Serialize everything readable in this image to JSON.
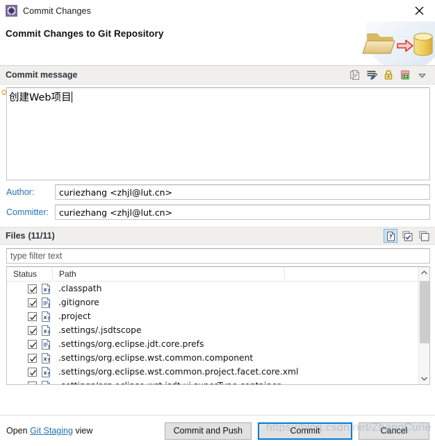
{
  "window": {
    "title": "Commit Changes",
    "icon": "commit-gear-icon",
    "close_label": "✕"
  },
  "header": {
    "title": "Commit Changes to Git Repository",
    "art": "folder-to-repository-icon"
  },
  "commit_message": {
    "section_label": "Commit message",
    "value": "创建Web项目",
    "toolbar": [
      {
        "name": "insert-signed-off-icon",
        "tooltip": "Add Signed-off-by"
      },
      {
        "name": "insert-change-id-icon",
        "tooltip": "Add Change-Id"
      },
      {
        "name": "amend-lock-icon",
        "tooltip": "Amend"
      },
      {
        "name": "sign-commit-icon",
        "tooltip": "Sign Commit"
      },
      {
        "name": "chevron-down-icon",
        "tooltip": "More"
      }
    ]
  },
  "author": {
    "label": "Author:",
    "value": "curiezhang <zhjl@lut.cn>"
  },
  "committer": {
    "label": "Committer:",
    "value": "curiezhang <zhjl@lut.cn>"
  },
  "files": {
    "title": "Files",
    "count": "(11/11)",
    "tools": [
      {
        "name": "show-untracked-files-icon",
        "active": true
      },
      {
        "name": "select-all-icon",
        "active": false
      },
      {
        "name": "deselect-all-icon",
        "active": false
      }
    ],
    "filter_placeholder": "type filter text",
    "columns": [
      "Status",
      "Path"
    ],
    "rows": [
      {
        "checked": true,
        "icon": "xml-file-icon",
        "path": ".classpath"
      },
      {
        "checked": true,
        "icon": "text-file-icon",
        "path": ".gitignore"
      },
      {
        "checked": true,
        "icon": "xml-file-icon",
        "path": ".project"
      },
      {
        "checked": true,
        "icon": "xml-file-icon",
        "path": ".settings/.jsdtscope"
      },
      {
        "checked": true,
        "icon": "text-file-icon",
        "path": ".settings/org.eclipse.jdt.core.prefs"
      },
      {
        "checked": true,
        "icon": "xml-file-icon",
        "path": ".settings/org.eclipse.wst.common.component"
      },
      {
        "checked": true,
        "icon": "xml-file-icon",
        "path": ".settings/org.eclipse.wst.common.project.facet.core.xml"
      },
      {
        "checked": true,
        "icon": "text-file-icon",
        "path": ".settings/org.eclipse.wst.jsdt.ui.superType.container"
      }
    ]
  },
  "footer": {
    "open_prefix": "Open ",
    "open_link": "Git Staging",
    "open_suffix": " view",
    "buttons": [
      {
        "label": "Commit and Push",
        "default": false
      },
      {
        "label": "Commit",
        "default": true
      },
      {
        "label": "Cancel",
        "default": false
      }
    ]
  },
  "watermark": "https://blog.csdn.net/ZhangCurie",
  "colors": {
    "accent_link": "#2372b5",
    "default_button_border": "#0078d7",
    "section_bar": "#f0efeb",
    "topline": "#1f4e79"
  }
}
